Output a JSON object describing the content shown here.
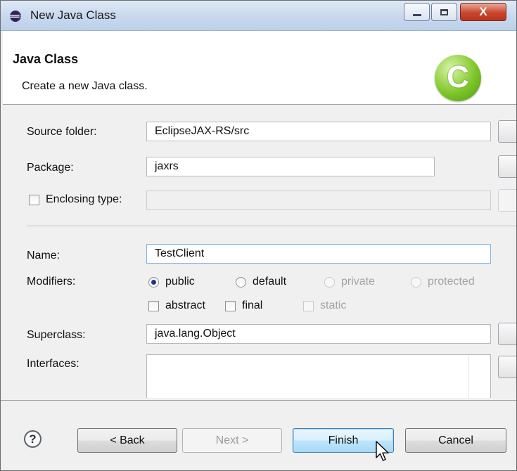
{
  "window": {
    "title": "New Java Class",
    "controls": {
      "minimize": "minimize",
      "maximize": "maximize",
      "close": "X"
    }
  },
  "header": {
    "title": "Java Class",
    "description": "Create a new Java class.",
    "logo_letter": "C"
  },
  "form": {
    "source_folder": {
      "label": "Source folder:",
      "value": "EclipseJAX-RS/src"
    },
    "package": {
      "label": "Package:",
      "value": "jaxrs"
    },
    "enclosing_type": {
      "label": "Enclosing type:",
      "value": "",
      "checked": false
    },
    "name": {
      "label": "Name:",
      "value": "TestClient"
    },
    "modifiers": {
      "label": "Modifiers:",
      "access": [
        "public",
        "default",
        "private",
        "protected"
      ],
      "selected": "public",
      "flags": [
        "abstract",
        "final",
        "static"
      ]
    },
    "superclass": {
      "label": "Superclass:",
      "value": "java.lang.Object"
    },
    "interfaces": {
      "label": "Interfaces:",
      "items": []
    }
  },
  "footer": {
    "help": "?",
    "back": "< Back",
    "next": "Next >",
    "finish": "Finish",
    "cancel": "Cancel"
  },
  "colors": {
    "title_gradient": "#c7d8ee",
    "close_button": "#c9462c",
    "logo_green": "#7fc62a",
    "radio_dot": "#22338a",
    "focused_button": "#bee6fd"
  },
  "icons": [
    "eclipse-icon",
    "minimize-icon",
    "maximize-icon",
    "close-icon",
    "class-logo-icon",
    "help-icon",
    "mouse-cursor-icon"
  ]
}
